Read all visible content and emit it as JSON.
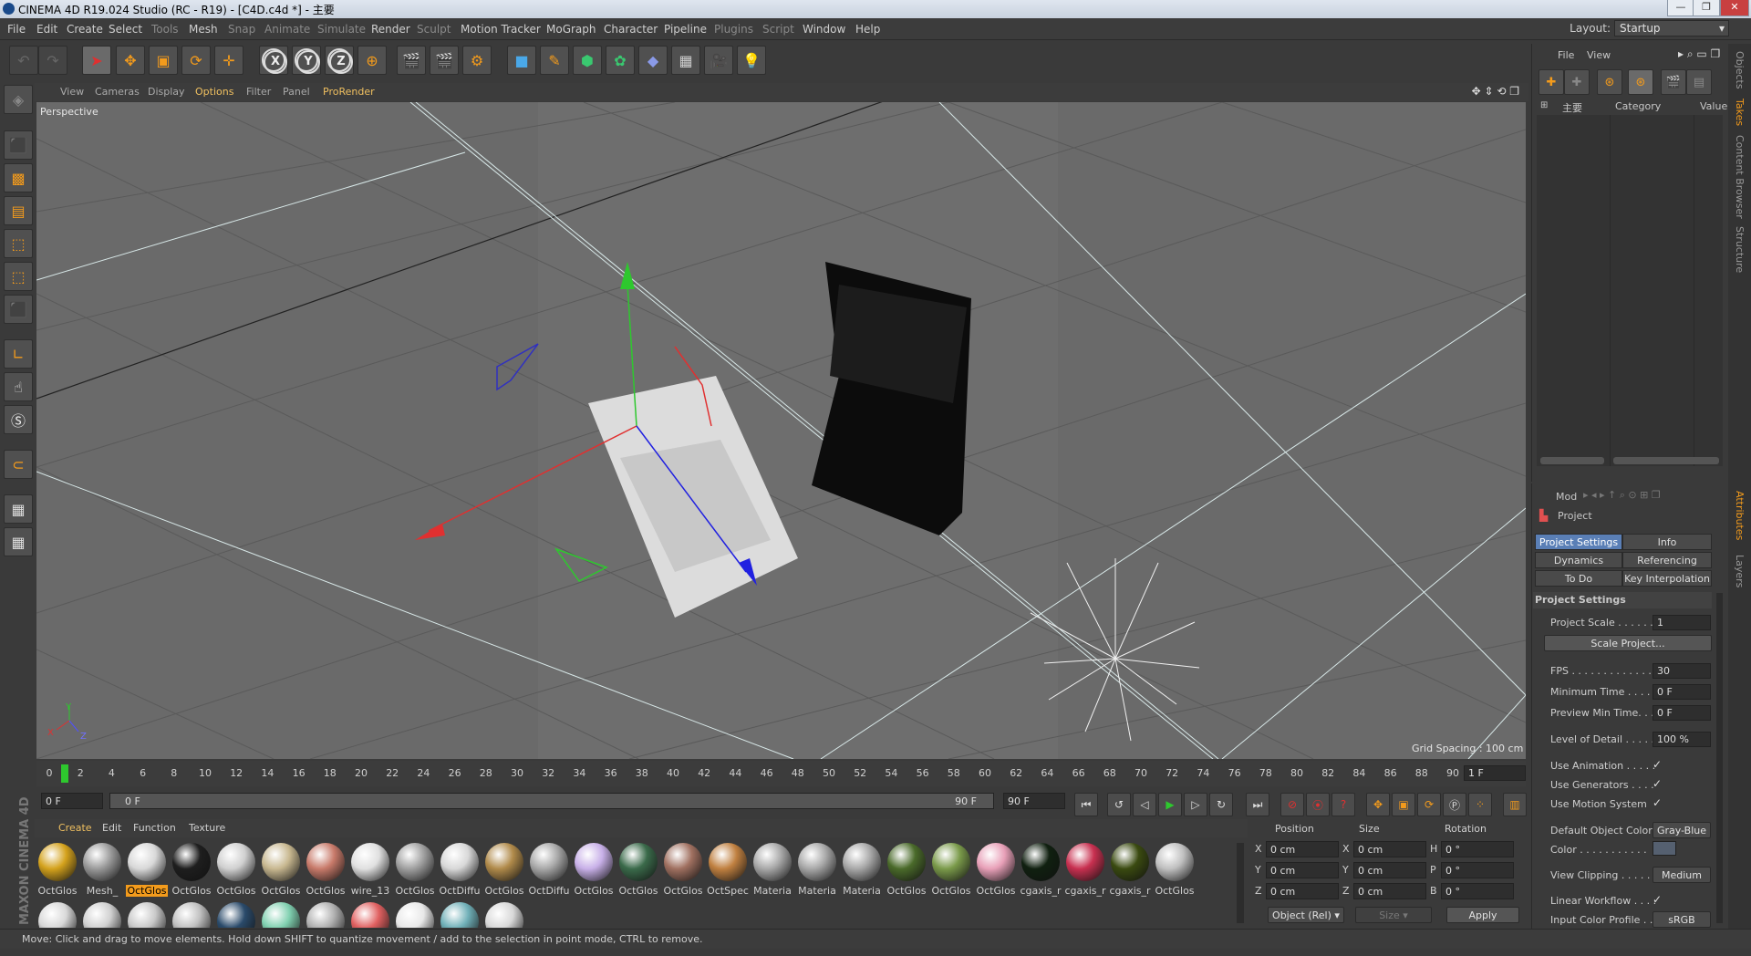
{
  "window": {
    "title": "CINEMA 4D R19.024 Studio (RC - R19) - [C4D.c4d *] - 主要",
    "min": "—",
    "max": "❐",
    "close": "✕"
  },
  "menubar": {
    "items": [
      "File",
      "Edit",
      "Create",
      "Select",
      "Tools",
      "Mesh",
      "Snap",
      "Animate",
      "Simulate",
      "Render",
      "Sculpt",
      "Motion Tracker",
      "MoGraph",
      "Character",
      "Pipeline",
      "Plugins",
      "Script",
      "Window",
      "Help"
    ],
    "layout_label": "Layout:",
    "layout_value": "Startup"
  },
  "viewport": {
    "menu": [
      "View",
      "Cameras",
      "Display",
      "Options",
      "Filter",
      "Panel",
      "ProRender"
    ],
    "camera": "Perspective",
    "grid_spacing": "Grid Spacing : 100 cm",
    "axis_labels": [
      "Y",
      "X",
      "Z"
    ]
  },
  "timeline": {
    "ticks": [
      "0",
      "2",
      "4",
      "6",
      "8",
      "10",
      "12",
      "14",
      "16",
      "18",
      "20",
      "22",
      "24",
      "26",
      "28",
      "30",
      "32",
      "34",
      "36",
      "38",
      "40",
      "42",
      "44",
      "46",
      "48",
      "50",
      "52",
      "54",
      "56",
      "58",
      "60",
      "62",
      "64",
      "66",
      "68",
      "70",
      "72",
      "74",
      "76",
      "78",
      "80",
      "82",
      "84",
      "86",
      "88",
      "90"
    ],
    "current_marker": "1 2",
    "current_frame": "1 F",
    "start_field": "0 F",
    "range_start": "0 F",
    "range_end": "90 F",
    "end_field": "90 F"
  },
  "materials": {
    "menu": [
      "Create",
      "Edit",
      "Function",
      "Texture"
    ],
    "row1": [
      {
        "label": "OctGlos",
        "color": "#d4a21c"
      },
      {
        "label": "Mesh_",
        "color": "#9a9a9a"
      },
      {
        "label": "OctGlos",
        "color": "#d8d8d8",
        "highlight": true
      },
      {
        "label": "OctGlos",
        "color": "#1e1e1e"
      },
      {
        "label": "OctGlos",
        "color": "#d0d0d0"
      },
      {
        "label": "OctGlos",
        "color": "#c8b890"
      },
      {
        "label": "OctGlos",
        "color": "#c87a6a"
      },
      {
        "label": "wire_13",
        "color": "#e0e0e0"
      },
      {
        "label": "OctGlos",
        "color": "#a0a0a0"
      },
      {
        "label": "OctDiffu",
        "color": "#d8d8d8"
      },
      {
        "label": "OctGlos",
        "color": "#b08a4a"
      },
      {
        "label": "OctDiffu",
        "color": "#a8a8a8"
      },
      {
        "label": "OctGlos",
        "color": "#c8b0e8"
      },
      {
        "label": "OctGlos",
        "color": "#3a6a4a"
      },
      {
        "label": "OctGlos",
        "color": "#a07060"
      },
      {
        "label": "OctSpec",
        "color": "#c08040"
      },
      {
        "label": "Materia",
        "color": "#a8a8a8"
      },
      {
        "label": "Materia",
        "color": "#a8a8a8"
      },
      {
        "label": "Materia",
        "color": "#a8a8a8"
      },
      {
        "label": "OctGlos",
        "color": "#4a6a2a"
      },
      {
        "label": "OctGlos",
        "color": "#7a9a4a"
      },
      {
        "label": "OctGlos",
        "color": "#e8a0b8"
      },
      {
        "label": "cgaxis_r",
        "color": "#102010"
      },
      {
        "label": "cgaxis_r",
        "color": "#c83050"
      },
      {
        "label": "cgaxis_r",
        "color": "#3a4a10"
      },
      {
        "label": "OctGlos",
        "color": "#c0c0c0"
      }
    ],
    "row2_colors": [
      "#d8d8d8",
      "#d0d0d0",
      "#c8c8c8",
      "#c0c0c0",
      "#2a4a6a",
      "#80d0b0",
      "#b0b0b0",
      "#e06060",
      "#e8e8e8",
      "#70b0b8",
      "#d8d8d8"
    ]
  },
  "coords": {
    "headers": [
      "Position",
      "Size",
      "Rotation"
    ],
    "pos": [
      [
        "X",
        "0 cm"
      ],
      [
        "Y",
        "0 cm"
      ],
      [
        "Z",
        "0 cm"
      ]
    ],
    "size": [
      [
        "X",
        "0 cm"
      ],
      [
        "Y",
        "0 cm"
      ],
      [
        "Z",
        "0 cm"
      ]
    ],
    "rot": [
      [
        "H",
        "0 °"
      ],
      [
        "P",
        "0 °"
      ],
      [
        "B",
        "0 °"
      ]
    ],
    "mode": "Object (Rel)",
    "size_mode": "Size",
    "apply": "Apply"
  },
  "objects": {
    "menu": [
      "File",
      "View"
    ],
    "tree_item": "主要",
    "columns": [
      "Category",
      "Value"
    ]
  },
  "attributes": {
    "mode": "Mod",
    "title": "Project",
    "tabs": [
      "Project Settings",
      "Info",
      "Dynamics",
      "Referencing",
      "To Do",
      "Key Interpolation"
    ],
    "section": "Project Settings",
    "project_scale_label": "Project Scale . . . . . .",
    "project_scale": "1",
    "scale_button": "Scale Project...",
    "fps_label": "FPS . . . . . . . . . . . . .",
    "fps": "30",
    "min_time_label": "Minimum Time . . . .",
    "min_time": "0 F",
    "preview_min_label": "Preview Min Time. . .",
    "preview_min": "0 F",
    "lod_label": "Level of Detail . . . . .",
    "lod": "100 %",
    "use_animation": "Use Animation . . . . .",
    "use_generators": "Use Generators . . . .",
    "use_motion": "Use Motion System",
    "check": "✓",
    "default_color_label": "Default Object Color",
    "default_color": "Gray-Blue",
    "color_label": "Color . . . . . . . . . . .",
    "view_clipping_label": "View Clipping . . . . . .",
    "view_clipping": "Medium",
    "linear_workflow": "Linear Workflow . . . .",
    "input_color_label": "Input Color Profile . .",
    "input_color": "sRGB"
  },
  "side_tabs": [
    "Objects",
    "Takes",
    "Content Browser",
    "Structure",
    "Attributes",
    "Layers"
  ],
  "status": "Move: Click and drag to move elements. Hold down SHIFT to quantize movement / add to the selection in point mode, CTRL to remove.",
  "brand": "MAXON CINEMA 4D",
  "colors": {
    "accent": "#f39b1c",
    "active_tab": "#5a7fb6",
    "viewport_bg": "#6a6a6a"
  }
}
